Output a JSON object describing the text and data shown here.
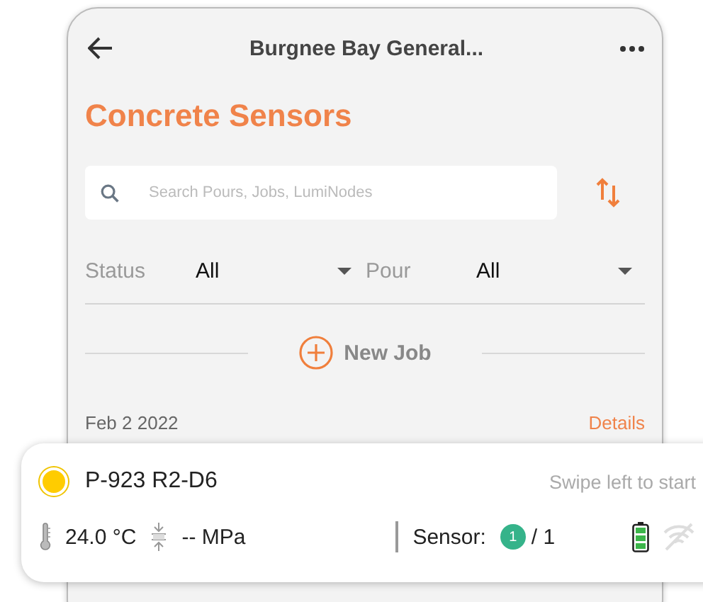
{
  "header": {
    "title": "Burgnee Bay General..."
  },
  "page_title": "Concrete Sensors",
  "search": {
    "placeholder": "Search Pours, Jobs, LumiNodes"
  },
  "filters": [
    {
      "label": "Status",
      "value": "All"
    },
    {
      "label": "Pour",
      "value": "All"
    }
  ],
  "new_job": {
    "label": "New Job"
  },
  "job": {
    "date": "Feb 2 2022",
    "details": "Details"
  },
  "sensors": [
    {
      "name": "P-923 R2-D6",
      "color": "#ffcc00",
      "hint": "Swipe left to start",
      "temperature": "24.0 °C",
      "strength": "-- MPa",
      "sensor_label": "Sensor:",
      "sensor_count": "1",
      "sensor_total": "/ 1"
    }
  ]
}
